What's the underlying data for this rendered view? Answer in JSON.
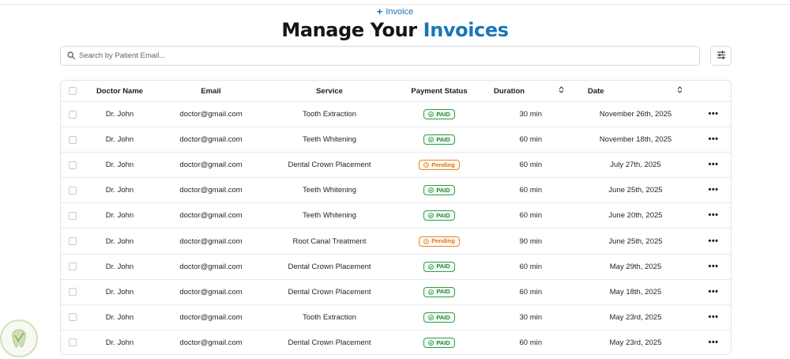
{
  "header": {
    "add_button_icon": "plus-icon",
    "add_button_label": "Invoice",
    "title_prefix": "Manage Your",
    "title_accent": "Invoices",
    "accent_color": "#1a76b8"
  },
  "search": {
    "icon": "search-icon",
    "placeholder": "Search by Patient Email...",
    "value": ""
  },
  "filter_button": {
    "icon": "sliders-icon"
  },
  "table": {
    "columns": {
      "doctor": "Doctor Name",
      "email": "Email",
      "service": "Service",
      "status": "Payment Status",
      "duration": "Duration",
      "date": "Date"
    },
    "sortable_icon": "sort-updown-icon",
    "status_colors": {
      "PAID": "#23873c",
      "Pending": "#d6781a"
    },
    "rows": [
      {
        "doctor": "Dr. John",
        "email": "doctor@gmail.com",
        "service": "Tooth Extraction",
        "status": "PAID",
        "duration": "30 min",
        "date": "November 26th, 2025"
      },
      {
        "doctor": "Dr. John",
        "email": "doctor@gmail.com",
        "service": "Teeth Whitening",
        "status": "PAID",
        "duration": "60 min",
        "date": "November 18th, 2025"
      },
      {
        "doctor": "Dr. John",
        "email": "doctor@gmail.com",
        "service": "Dental Crown Placement",
        "status": "Pending",
        "duration": "60 min",
        "date": "July 27th, 2025"
      },
      {
        "doctor": "Dr. John",
        "email": "doctor@gmail.com",
        "service": "Teeth Whitening",
        "status": "PAID",
        "duration": "60 min",
        "date": "June 25th, 2025"
      },
      {
        "doctor": "Dr. John",
        "email": "doctor@gmail.com",
        "service": "Teeth Whitening",
        "status": "PAID",
        "duration": "60 min",
        "date": "June 20th, 2025"
      },
      {
        "doctor": "Dr. John",
        "email": "doctor@gmail.com",
        "service": "Root Canal Treatment",
        "status": "Pending",
        "duration": "90 min",
        "date": "June 25th, 2025"
      },
      {
        "doctor": "Dr. John",
        "email": "doctor@gmail.com",
        "service": "Dental Crown Placement",
        "status": "PAID",
        "duration": "60 min",
        "date": "May 29th, 2025"
      },
      {
        "doctor": "Dr. John",
        "email": "doctor@gmail.com",
        "service": "Dental Crown Placement",
        "status": "PAID",
        "duration": "60 min",
        "date": "May 18th, 2025"
      },
      {
        "doctor": "Dr. John",
        "email": "doctor@gmail.com",
        "service": "Tooth Extraction",
        "status": "PAID",
        "duration": "30 min",
        "date": "May 23rd, 2025"
      },
      {
        "doctor": "Dr. John",
        "email": "doctor@gmail.com",
        "service": "Dental Crown Placement",
        "status": "PAID",
        "duration": "60 min",
        "date": "May 23rd, 2025"
      }
    ]
  },
  "row_actions_icon": "more-horizontal-icon",
  "watermark_logo": "dental-logo"
}
